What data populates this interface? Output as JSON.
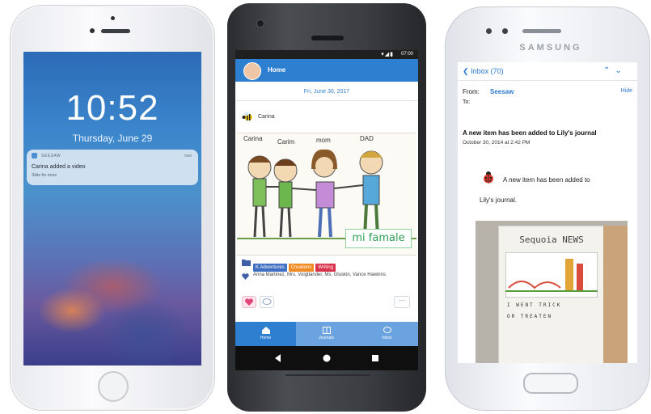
{
  "iphone": {
    "time": "10:52",
    "date": "Thursday, June 29",
    "notification": {
      "app": "SEESAW",
      "when": "now",
      "message": "Carina added a video",
      "hint": "Slide for more"
    }
  },
  "android": {
    "status_time": "07:00",
    "app_title": "Home",
    "post_date": "Fri, June 30, 2017",
    "author": "Carina",
    "drawing": {
      "labels": [
        "Carina",
        "Carim",
        "mom",
        "DAD"
      ],
      "caption": "mi famale"
    },
    "tags": [
      {
        "label": "K Adventures",
        "color": "#3f6fc2"
      },
      {
        "label": "Creations",
        "color": "#f28a22"
      },
      {
        "label": "Writing",
        "color": "#d8334a"
      }
    ],
    "likers": "Anna Martinez, Mrs. Voigtlander, Ms. Gluskin, Vance Hawkins",
    "more_label": "···",
    "nav": [
      {
        "label": "Home",
        "icon": "home-icon"
      },
      {
        "label": "Journals",
        "icon": "book-icon"
      },
      {
        "label": "Inbox",
        "icon": "chat-icon"
      }
    ]
  },
  "samsung": {
    "brand": "SAMSUNG",
    "back_label": "Inbox (70)",
    "from_label": "From:",
    "from_value": "Seesaw",
    "hide_label": "Hide",
    "to_label": "To:",
    "subject": "A new item has been added to Lily's journal",
    "date": "October 30, 2014 at 2:42 PM",
    "body_line1": "A new item has been added to",
    "body_line2": "Lily's journal.",
    "photo_title": "Sequoia NEWS",
    "photo_line1": "I   WENT   TRICK",
    "photo_line2": "OR   TREATEN"
  }
}
